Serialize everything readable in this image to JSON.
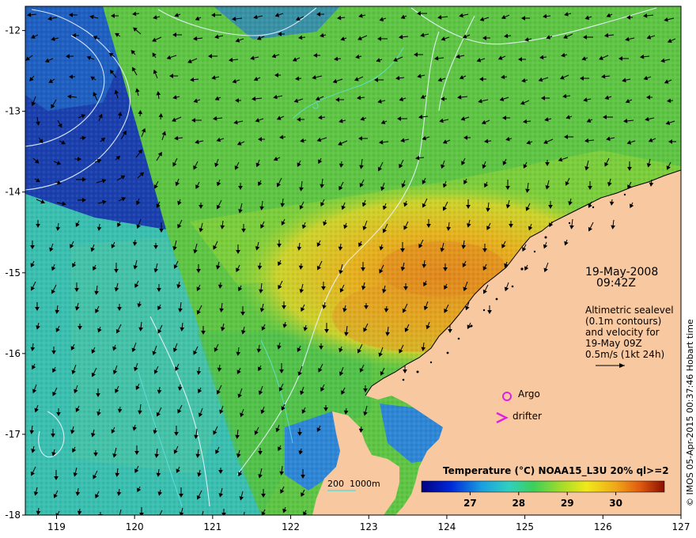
{
  "map": {
    "lon_ticks": [
      "119",
      "120",
      "121",
      "122",
      "123",
      "124",
      "125",
      "126",
      "127"
    ],
    "lat_ticks": [
      "-12",
      "-13",
      "-14",
      "-15",
      "-16",
      "-17",
      "-18"
    ],
    "lon_range": [
      118.6,
      127.0
    ],
    "lat_range": [
      -18.0,
      -11.7
    ],
    "land_color": "#f8c9a0",
    "ocean_colors": {
      "deep_blue": "#12329e",
      "cyan": "#34b7c8",
      "green": "#62c842",
      "yellow": "#e6d21e",
      "orange": "#e58a1e"
    }
  },
  "datetime": {
    "date": "19-May-2008",
    "time": "09:42Z"
  },
  "altimetry": {
    "line1": "Altimetric sealevel",
    "line2": "(0.1m contours)",
    "line3": "and velocity for",
    "line4": "19-May 09Z",
    "line5": "0.5m/s (1kt 24h)"
  },
  "legend": {
    "argo_label": "Argo",
    "drifter_label": "drifter",
    "argo_color": "#e020e0",
    "drifter_color": "#e020e0"
  },
  "bathymetry": {
    "label_200": "200",
    "label_1000": "1000m",
    "line_color": "#40e0e0"
  },
  "colorbar": {
    "title": "Temperature (°C) NOAA15_L3U 20% ql>=2",
    "ticks": [
      "27",
      "28",
      "29",
      "30"
    ],
    "range": [
      26.0,
      31.0
    ]
  },
  "credit": "© IMOS 05-Apr-2015 00:37:46 Hobart time"
}
